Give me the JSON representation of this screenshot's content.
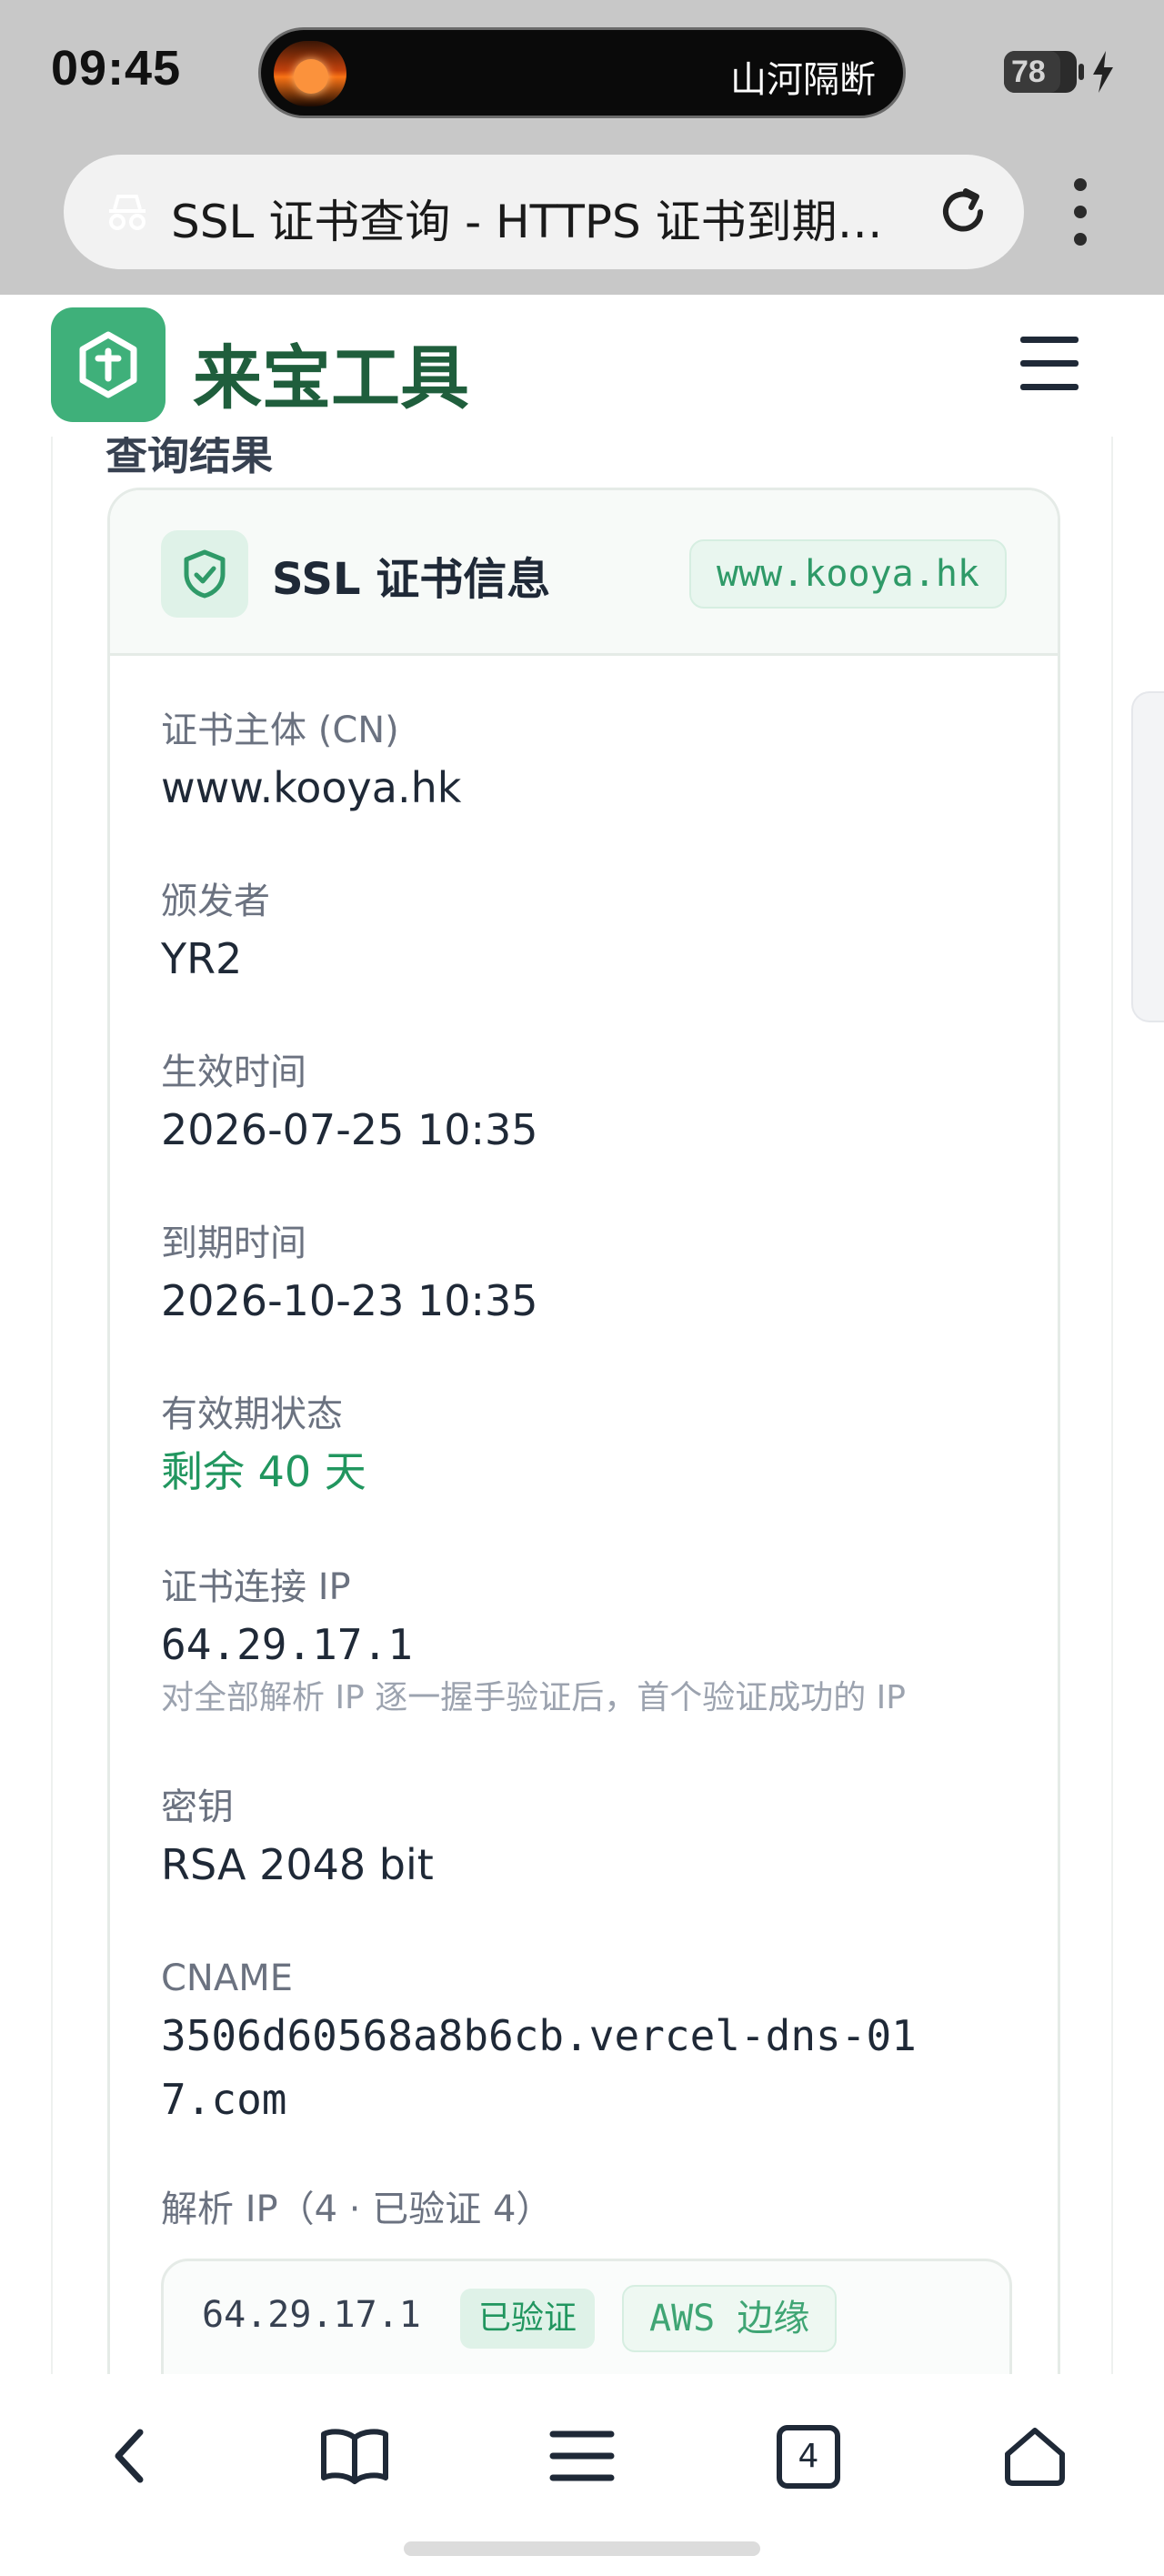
{
  "status_bar": {
    "time": "09:45",
    "island_text": "山河隔断",
    "battery": "78"
  },
  "browser": {
    "page_title": "SSL 证书查询 - HTTPS 证书到期…",
    "icons": [
      "incognito-icon",
      "reload-icon",
      "kebab-menu-icon"
    ]
  },
  "site": {
    "brand": "来宝工具",
    "icons": [
      "logo-icon",
      "hamburger-menu-icon"
    ]
  },
  "result": {
    "section_title": "查询结果",
    "card_title": "SSL 证书信息",
    "domain": "www.kooya.hk",
    "fields": {
      "subject_label": "证书主体 (CN)",
      "subject_value": "www.kooya.hk",
      "issuer_label": "颁发者",
      "issuer_value": "YR2",
      "valid_from_label": "生效时间",
      "valid_from_value": "2026-07-25 10:35",
      "valid_to_label": "到期时间",
      "valid_to_value": "2026-10-23 10:35",
      "status_label": "有效期状态",
      "status_value": "剩余 40 天",
      "conn_ip_label": "证书连接 IP",
      "conn_ip_value": "64.29.17.1",
      "conn_ip_note": "对全部解析 IP 逐一握手验证后，首个验证成功的 IP",
      "key_label": "密钥",
      "key_value": "RSA 2048 bit",
      "cname_label": "CNAME",
      "cname_value": "3506d60568a8b6cb.vercel-dns-017.com",
      "resolve_label": "解析 IP（4 · 已验证 4）"
    },
    "ip_rows": [
      {
        "ip": "64.29.17.1",
        "status": "已验证",
        "provider": "AWS 边缘"
      }
    ]
  },
  "bottom_nav": {
    "tab_count": "4",
    "icons": [
      "back-icon",
      "bookmarks-icon",
      "menu-icon",
      "tabs-icon",
      "home-icon"
    ]
  },
  "colors": {
    "brand_green": "#3fb07a",
    "brand_text": "#1f5e3c",
    "status_green": "#21965f"
  }
}
